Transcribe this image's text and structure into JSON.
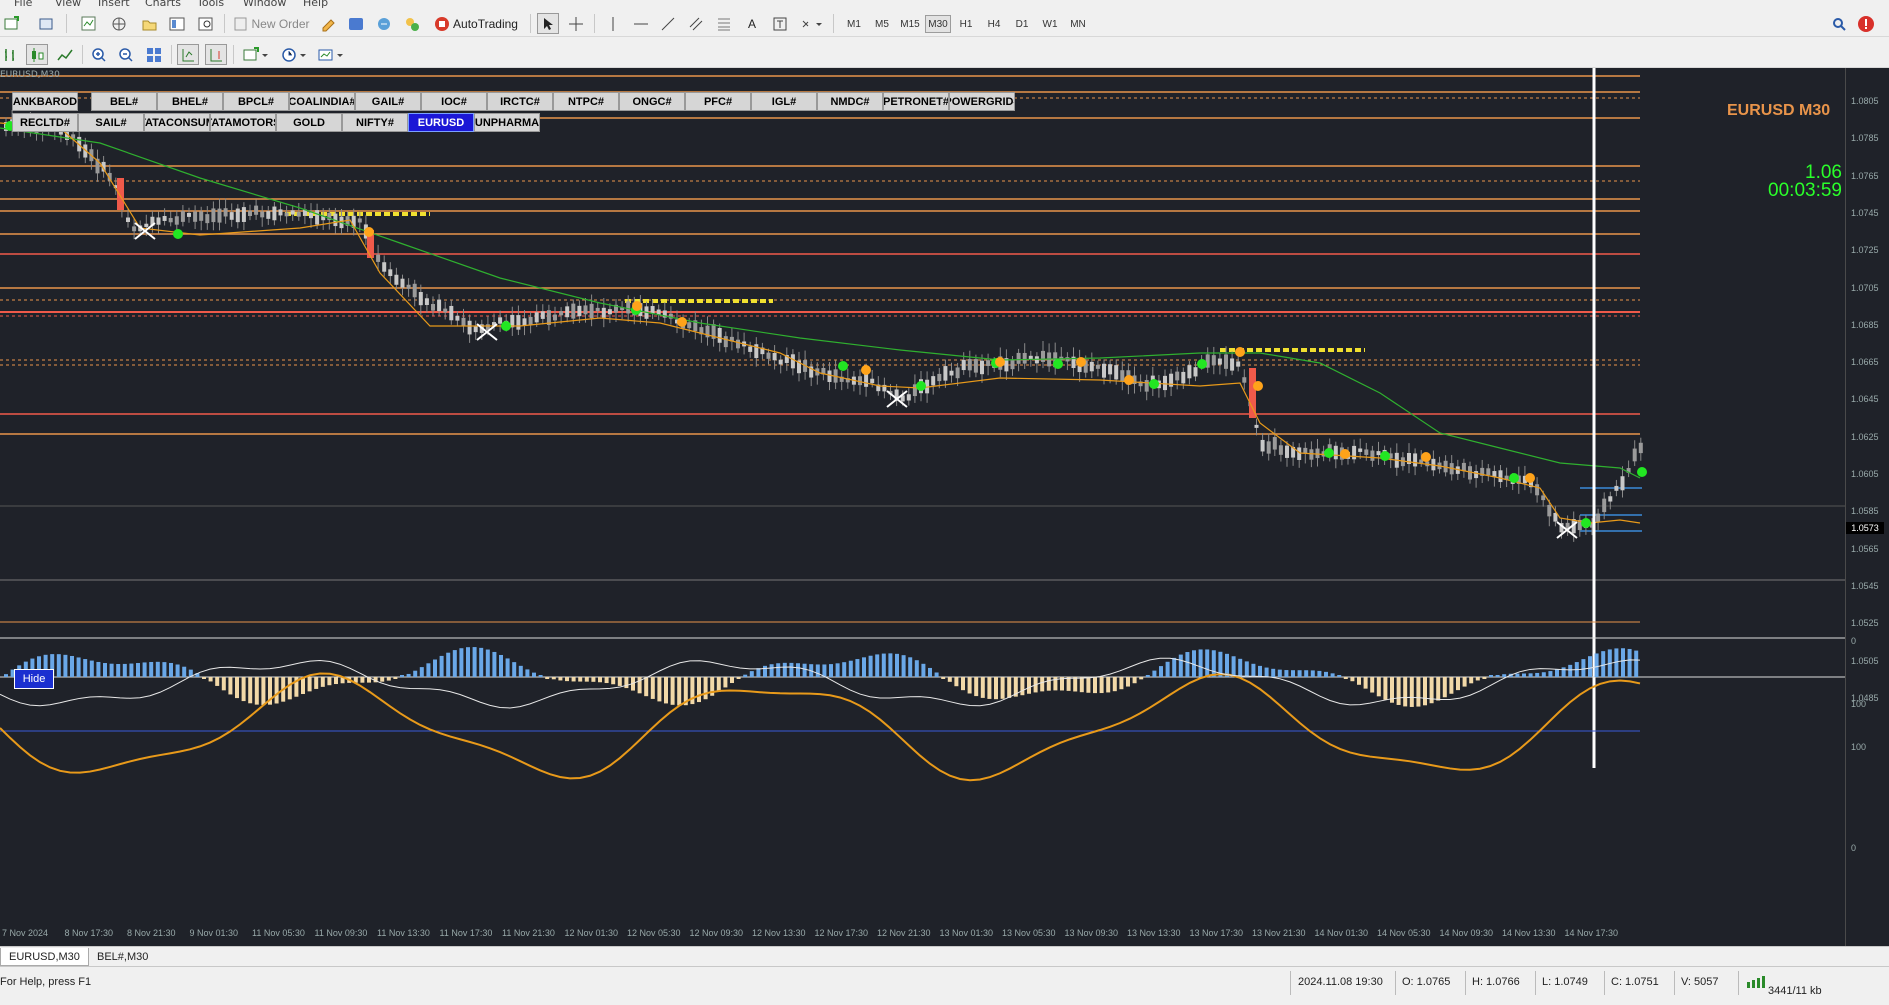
{
  "menu": [
    "File",
    "View",
    "Insert",
    "Charts",
    "Tools",
    "Window",
    "Help"
  ],
  "toolbar": {
    "new_order": "New Order",
    "autotrading": "AutoTrading",
    "timeframes": [
      "M1",
      "M5",
      "M15",
      "M30",
      "H1",
      "H4",
      "D1",
      "W1",
      "MN"
    ],
    "active_timeframe": "M30"
  },
  "chart": {
    "corner_label": "EURUSD,M30",
    "symbol_title": "EURUSD  M30",
    "spread": "1.06",
    "timer": "00:03:59",
    "hide_label": "Hide",
    "current_price": "1.0573",
    "symbol_buttons_row1": [
      "BANKBARODA",
      "BEL#",
      "BHEL#",
      "BPCL#",
      "COALINDIA#",
      "GAIL#",
      "IOC#",
      "IRCTC#",
      "NTPC#",
      "ONGC#",
      "PFC#",
      "IGL#",
      "NMDC#",
      "PETRONET#",
      "POWERGRID#"
    ],
    "symbol_buttons_row2": [
      "RECLTD#",
      "SAIL#",
      "TATACONSUM",
      "TATAMOTORS",
      "GOLD",
      "NIFTY#",
      "EURUSD",
      "UNPHARMA"
    ],
    "active_symbol": "EURUSD",
    "y_axis_labels": [
      "1.0805",
      "1.0785",
      "1.0765",
      "1.0745",
      "1.0725",
      "1.0705",
      "1.0685",
      "1.0665",
      "1.0645",
      "1.0625",
      "1.0605",
      "1.0585",
      "1.0565",
      "1.0545",
      "1.0525",
      "1.0505",
      "1.0485"
    ],
    "indicator_y_labels": [
      "0",
      "100",
      "100",
      "0"
    ],
    "x_axis_labels": [
      "7 Nov 2024",
      "8 Nov 17:30",
      "8 Nov 21:30",
      "9 Nov 01:30",
      "11 Nov 05:30",
      "11 Nov 09:30",
      "11 Nov 13:30",
      "11 Nov 17:30",
      "11 Nov 21:30",
      "12 Nov 01:30",
      "12 Nov 05:30",
      "12 Nov 09:30",
      "12 Nov 13:30",
      "12 Nov 17:30",
      "12 Nov 21:30",
      "13 Nov 01:30",
      "13 Nov 05:30",
      "13 Nov 09:30",
      "13 Nov 13:30",
      "13 Nov 17:30",
      "13 Nov 21:30",
      "14 Nov 01:30",
      "14 Nov 05:30",
      "14 Nov 09:30",
      "14 Nov 13:30",
      "14 Nov 17:30"
    ],
    "colors": {
      "background": "#1f2229",
      "orange_level": "#e8944a",
      "red_level": "#f05a4a",
      "ma_green": "#2fb02f",
      "ma_orange": "#e89a1a",
      "dot_green": "#22e622",
      "dot_orange": "#ffa31a",
      "histo_pos": "#6aa8e8",
      "histo_neg": "#f2d9a8"
    }
  },
  "tabs": [
    "EURUSD,M30",
    "BEL#,M30"
  ],
  "active_tab": "EURUSD,M30",
  "status": {
    "help": "For Help, press F1",
    "datetime": "2024.11.08 19:30",
    "open": "O: 1.0765",
    "high": "H: 1.0766",
    "low": "L: 1.0749",
    "close": "C: 1.0751",
    "volume": "V: 5057",
    "traffic": "3441/11 kb"
  }
}
